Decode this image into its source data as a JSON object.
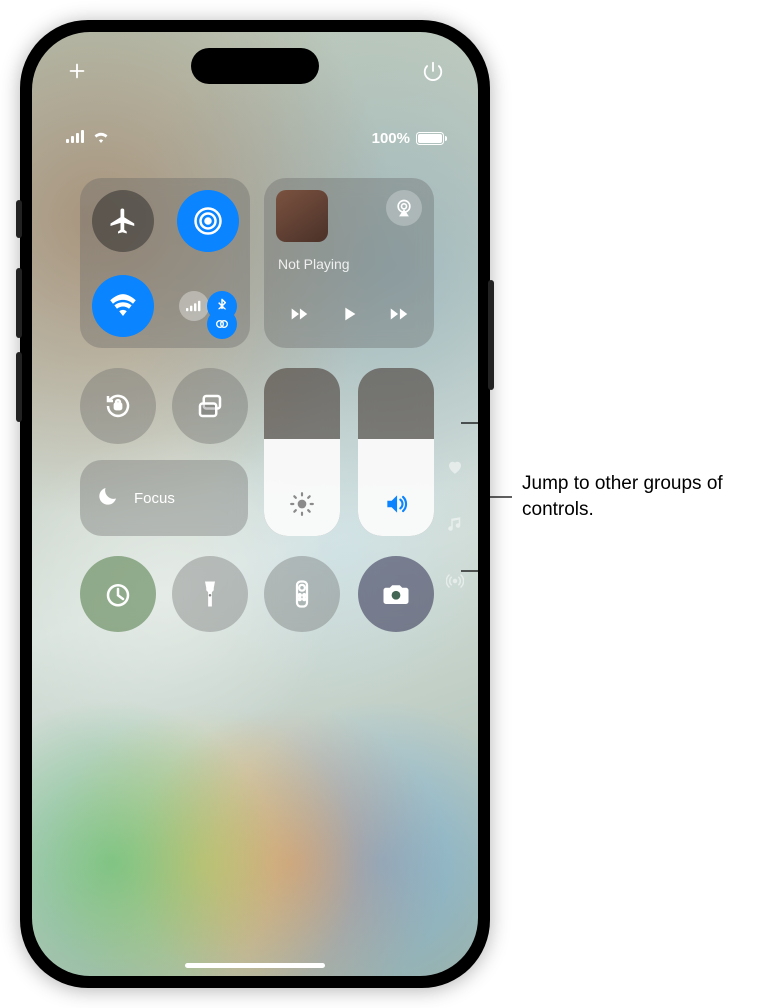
{
  "topbar": {
    "add_label": "Add",
    "power_label": "Power"
  },
  "status": {
    "battery_pct": "100%"
  },
  "connectivity": {
    "airplane": false,
    "airdrop": true,
    "wifi": true,
    "cellular_on": false,
    "bluetooth": true,
    "hotspot": true
  },
  "media": {
    "now_playing": "Not Playing"
  },
  "focus": {
    "label": "Focus"
  },
  "sliders": {
    "brightness_pct": 58,
    "volume_pct": 58
  },
  "page_indicators": {
    "items": [
      "favorites",
      "music",
      "connectivity"
    ],
    "active_index": 0
  },
  "callout": {
    "text": "Jump to other groups of controls."
  }
}
